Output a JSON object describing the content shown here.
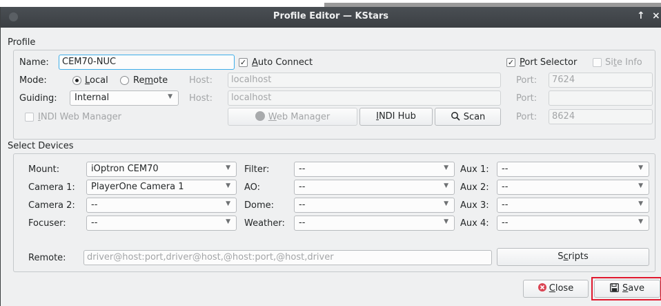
{
  "window": {
    "title": "Profile Editor — KStars",
    "controls": {
      "pin_glyph": "↑",
      "close_glyph": "×"
    }
  },
  "profile": {
    "group_title": "Profile",
    "name_label": "Name:",
    "name_value": "CEM70-NUC",
    "auto_connect": {
      "label": "Auto Connect",
      "checked": true
    },
    "port_selector": {
      "label": "Port Selector",
      "checked": true
    },
    "site_info": {
      "label": "Site Info",
      "checked": false
    },
    "mode_label": "Mode:",
    "mode_local": "Local",
    "mode_remote": "Remote",
    "mode_selected": "Local",
    "host_label": "Host:",
    "host_value_1": "localhost",
    "port_label": "Port:",
    "port_value_1": "7624",
    "guiding_label": "Guiding:",
    "guiding_value": "Internal",
    "host_value_2": "localhost",
    "port_value_2": "",
    "indi_web_manager": {
      "label": "INDI Web Manager",
      "checked": false
    },
    "web_manager_button": "Web Manager",
    "indi_hub_button": "INDI Hub",
    "scan_button": "Scan",
    "port_value_3": "8624"
  },
  "devices": {
    "group_title": "Select Devices",
    "mount_label": "Mount:",
    "mount_value": "iOptron CEM70",
    "camera1_label": "Camera 1:",
    "camera1_value": "PlayerOne Camera 1",
    "camera2_label": "Camera 2:",
    "camera2_value": "--",
    "focuser_label": "Focuser:",
    "focuser_value": "--",
    "filter_label": "Filter:",
    "filter_value": "--",
    "ao_label": "AO:",
    "ao_value": "--",
    "dome_label": "Dome:",
    "dome_value": "--",
    "weather_label": "Weather:",
    "weather_value": "--",
    "aux1_label": "Aux 1:",
    "aux1_value": "--",
    "aux2_label": "Aux 2:",
    "aux2_value": "--",
    "aux3_label": "Aux 3:",
    "aux3_value": "--",
    "aux4_label": "Aux 4:",
    "aux4_value": "--",
    "remote_label": "Remote:",
    "remote_placeholder": "driver@host:port,driver@host,@host:port,@host,driver",
    "scripts_button": "Scripts"
  },
  "footer": {
    "close_button": "Close",
    "save_button": "Save"
  },
  "colors": {
    "titlebar": "#3b3f43",
    "window_bg": "#eff0f1",
    "focus_accent": "#3daee9",
    "close_icon": "#da4453",
    "highlight_box": "#e0182d"
  },
  "icons": {
    "checkbox": "check-mark",
    "web_manager": "web-manager-icon",
    "scan": "search-icon",
    "close": "close-circle-icon",
    "save": "floppy-disk-icon"
  }
}
